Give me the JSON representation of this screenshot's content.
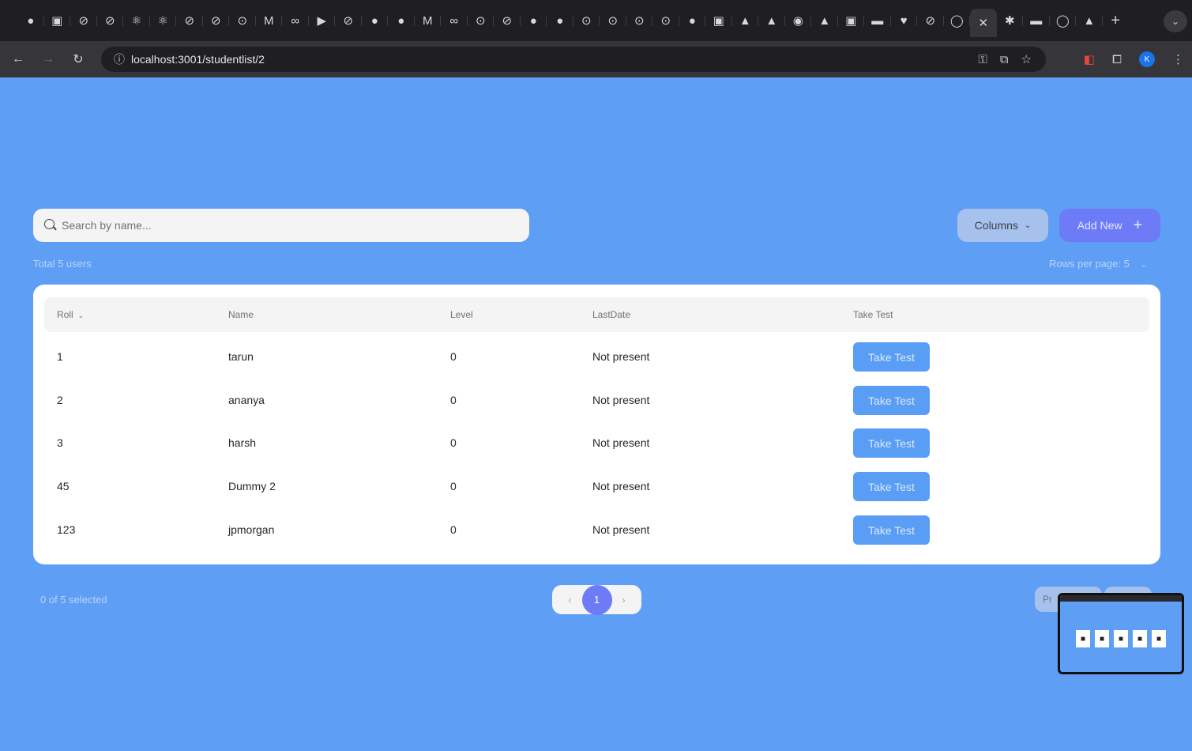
{
  "browser": {
    "tab_icons": [
      "●",
      "▣",
      "⊘",
      "⊘",
      "⚛",
      "⚛",
      "⊘",
      "⊘",
      "⊙",
      "M",
      "∞",
      "▶",
      "⊘",
      "●",
      "●",
      "M",
      "∞",
      "⊙",
      "⊘",
      "●",
      "●",
      "⊙",
      "⊙",
      "⊙",
      "⊙",
      "●",
      "▣",
      "▲",
      "▲",
      "◉",
      "▲",
      "▣",
      "▬",
      "♥",
      "⊘",
      "◯",
      "✕",
      "✱",
      "▬",
      "◯",
      "▲",
      "+"
    ],
    "close_tab": "✕",
    "new_tab": "+",
    "url": "localhost:3001/studentlist/2"
  },
  "search": {
    "placeholder": "Search by name..."
  },
  "actions": {
    "columns_label": "Columns",
    "add_new_label": "Add New"
  },
  "summary": {
    "total_users": "Total 5 users",
    "rows_per_page": "Rows per page: 5"
  },
  "table": {
    "headers": {
      "roll": "Roll",
      "name": "Name",
      "level": "Level",
      "last_date": "LastDate",
      "take_test": "Take Test"
    },
    "rows": [
      {
        "roll": "1",
        "name": "tarun",
        "level": "0",
        "last_date": "Not present",
        "action": "Take Test"
      },
      {
        "roll": "2",
        "name": "ananya",
        "level": "0",
        "last_date": "Not present",
        "action": "Take Test"
      },
      {
        "roll": "3",
        "name": "harsh",
        "level": "0",
        "last_date": "Not present",
        "action": "Take Test"
      },
      {
        "roll": "45",
        "name": "Dummy 2",
        "level": "0",
        "last_date": "Not present",
        "action": "Take Test"
      },
      {
        "roll": "123",
        "name": "jpmorgan",
        "level": "0",
        "last_date": "Not present",
        "action": "Take Test"
      }
    ]
  },
  "footer": {
    "selected": "0 of 5 selected",
    "current_page": "1",
    "prev_label": "Pr"
  },
  "colors": {
    "page_background": "#5f9ef5",
    "primary": "#6e7bf6",
    "take_test_button": "#5a9df4"
  }
}
